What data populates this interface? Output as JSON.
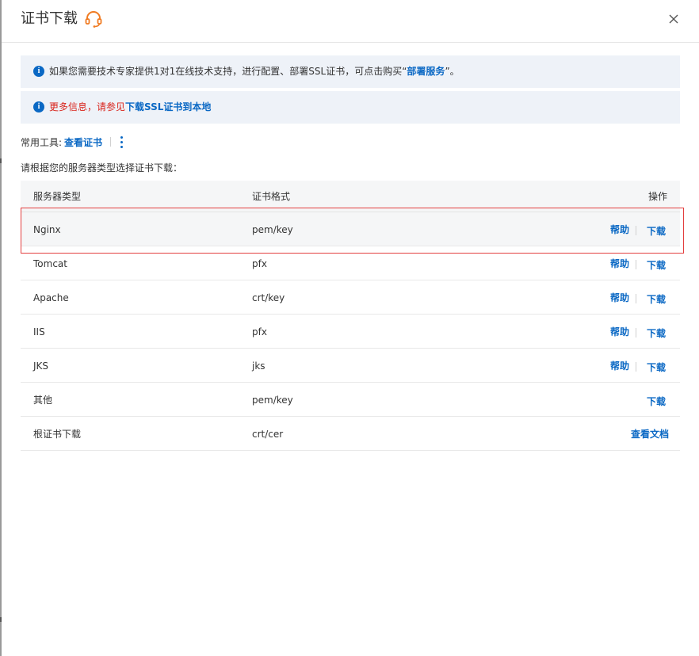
{
  "dialog": {
    "title": "证书下载"
  },
  "notices": [
    {
      "text_before": "如果您需要技术专家提供1对1在线技术支持，进行配置、部署SSL证书，可点击购买“",
      "link": "部署服务",
      "text_after": "”。"
    },
    {
      "text_red": "更多信息，请参见",
      "link": "下载SSL证书到本地"
    }
  ],
  "tools": {
    "label": "常用工具:",
    "view_cert": "查看证书"
  },
  "instruction": "请根据您的服务器类型选择证书下载：",
  "table": {
    "headers": [
      "服务器类型",
      "证书格式",
      "操作"
    ],
    "rows": [
      {
        "server": "Nginx",
        "format": "pem/key",
        "help": "帮助",
        "download": "下载"
      },
      {
        "server": "Tomcat",
        "format": "pfx",
        "help": "帮助",
        "download": "下载"
      },
      {
        "server": "Apache",
        "format": "crt/key",
        "help": "帮助",
        "download": "下载"
      },
      {
        "server": "IIS",
        "format": "pfx",
        "help": "帮助",
        "download": "下载"
      },
      {
        "server": "JKS",
        "format": "jks",
        "help": "帮助",
        "download": "下载"
      },
      {
        "server": "其他",
        "format": "pem/key",
        "download": "下载"
      },
      {
        "server": "根证书下载",
        "format": "crt/cer",
        "doc": "查看文档"
      }
    ]
  },
  "colors": {
    "accent": "#0a68c4",
    "warning": "#d9241c",
    "support_icon": "#f07b22",
    "highlight_border": "#e33e3e"
  },
  "icons": [
    "headset-icon",
    "close-icon",
    "info-icon",
    "more-vertical-icon"
  ]
}
